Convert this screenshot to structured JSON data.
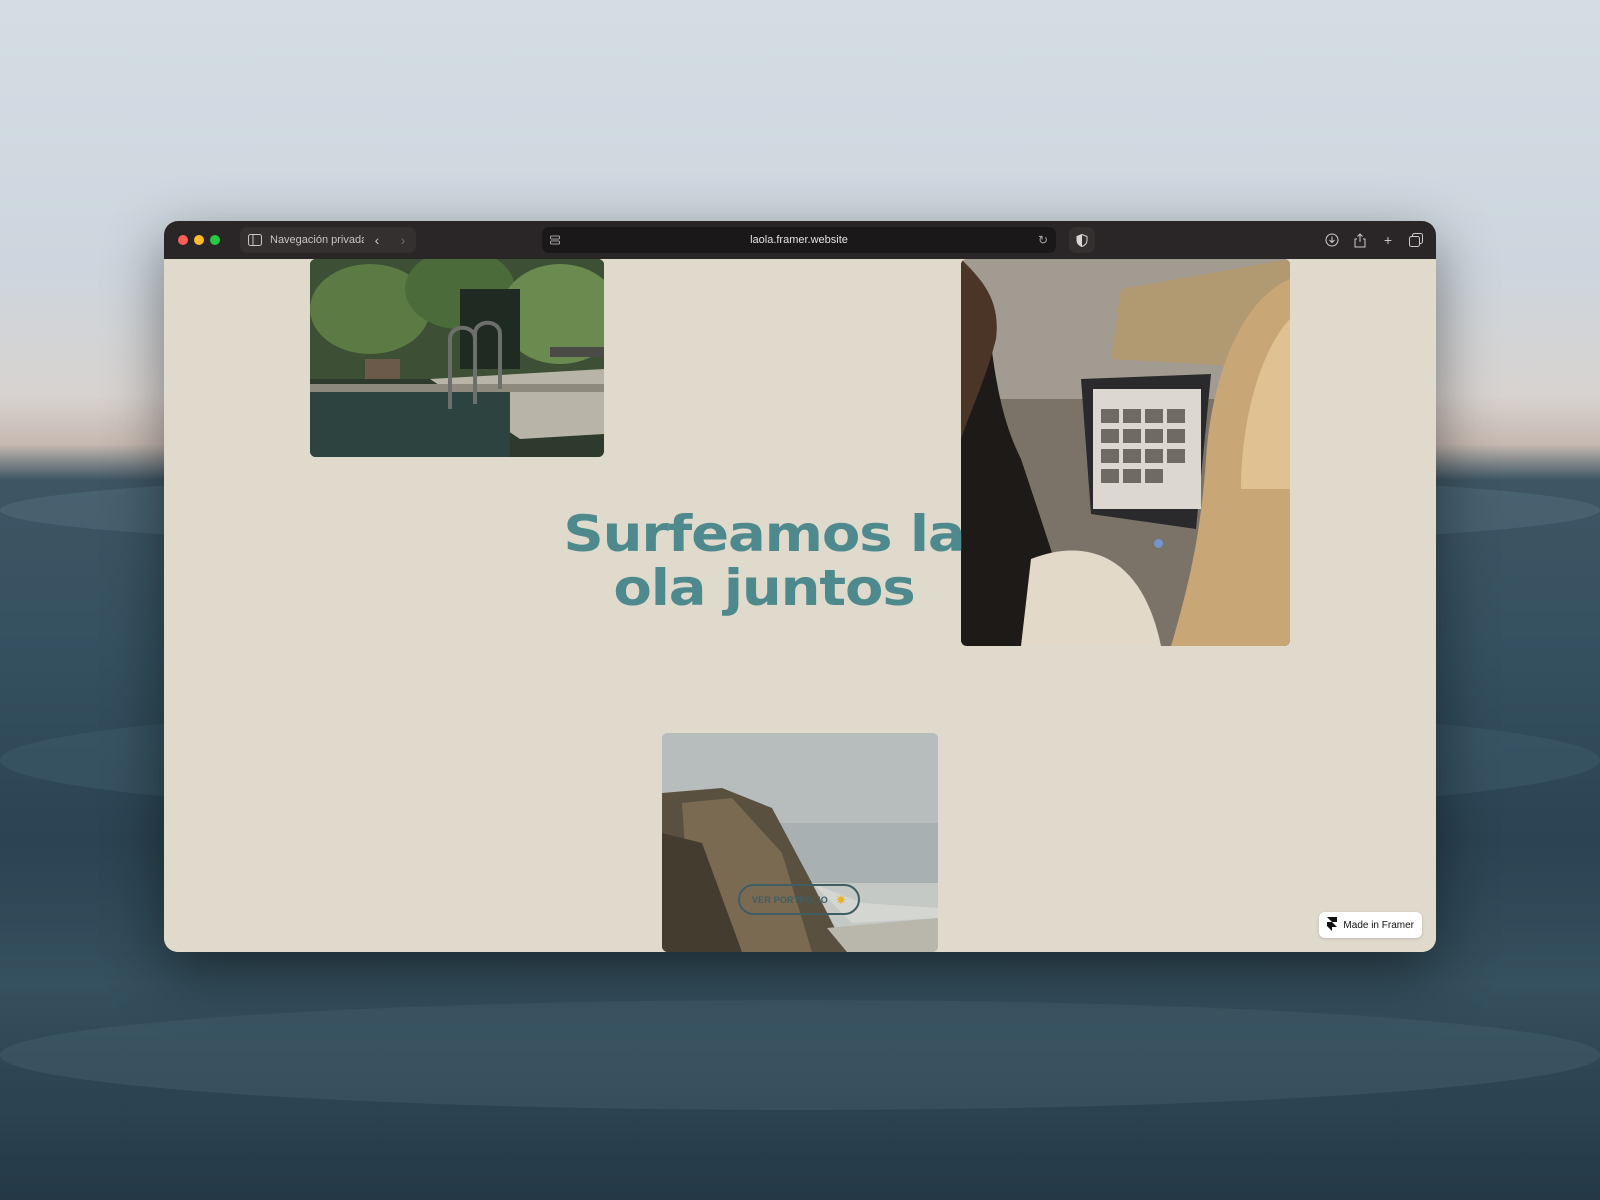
{
  "browser": {
    "private_label": "Navegación privada",
    "url": "laola.framer.website",
    "traffic_lights": [
      "#ff5f57",
      "#febc2e",
      "#28c840"
    ]
  },
  "hero": {
    "headline_line1": "Surfeamos la",
    "headline_line2": "ola juntos",
    "cta_label": "VER PORTFOLIO",
    "accent_color": "#4e8a8d"
  },
  "badge": {
    "label": "Made in Framer"
  },
  "icons": [
    "sidebar-icon",
    "back-icon",
    "forward-icon",
    "tab-list-icon",
    "reload-icon",
    "shield-icon",
    "download-icon",
    "share-icon",
    "new-tab-icon",
    "tabs-overview-icon",
    "sun-icon",
    "framer-logo-icon"
  ]
}
